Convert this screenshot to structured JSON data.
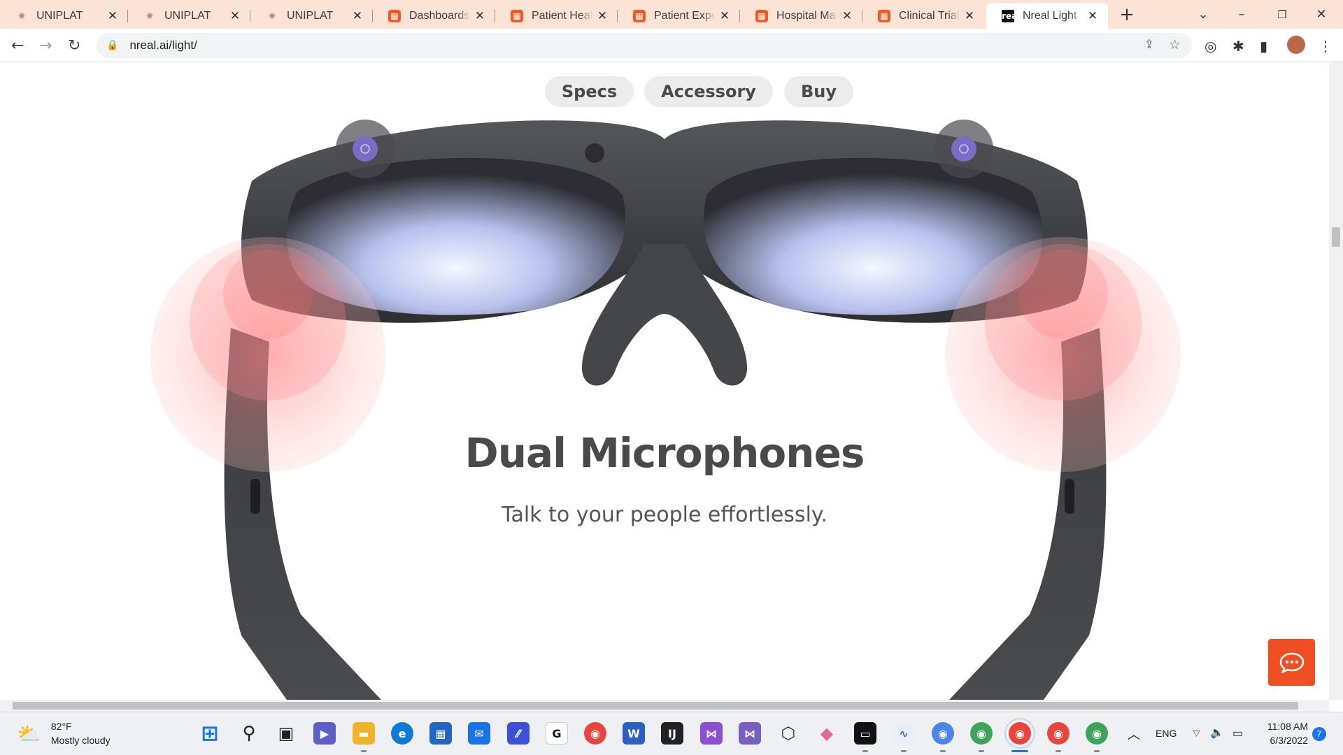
{
  "browser": {
    "tabs": [
      {
        "title": "UNIPLAT",
        "favicon": "uniplat-icon"
      },
      {
        "title": "UNIPLAT",
        "favicon": "uniplat-icon"
      },
      {
        "title": "UNIPLAT",
        "favicon": "uniplat-icon"
      },
      {
        "title": "Dashboards - I",
        "favicon": "orange-app-icon"
      },
      {
        "title": "Patient Health",
        "favicon": "orange-app-icon"
      },
      {
        "title": "Patient Experie",
        "favicon": "orange-app-icon"
      },
      {
        "title": "Hospital Mana",
        "favicon": "orange-app-icon"
      },
      {
        "title": "Clinical Trials D",
        "favicon": "orange-app-icon"
      },
      {
        "title": "Nreal Light",
        "favicon": "nreal-icon",
        "active": true
      }
    ],
    "nreal_favicon_text": "nreal",
    "new_tab_glyph": "+",
    "url": "nreal.ai/light/"
  },
  "page": {
    "nav": [
      "Specs",
      "Accessory",
      "Buy"
    ],
    "headline": "Dual Microphones",
    "subline": "Talk to your people effortlessly."
  },
  "taskbar": {
    "weather": {
      "temp": "82°F",
      "condition": "Mostly cloudy"
    },
    "language": "ENG",
    "time": "11:08 AM",
    "date": "6/3/2022",
    "notification_count": "7"
  },
  "colors": {
    "tabbar_bg": "#fce3d6",
    "brand_orange": "#f04e23",
    "glasses_body": "#3a3a3d",
    "mic_highlight": "#ff6b6b"
  }
}
